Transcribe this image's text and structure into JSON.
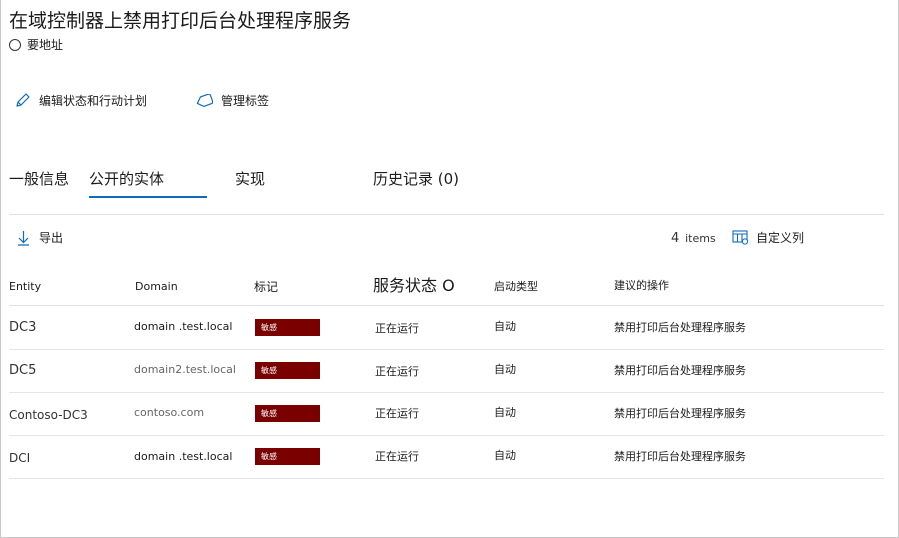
{
  "header": {
    "title": "在域控制器上禁用打印后台处理程序服务",
    "severity_label": "要地址"
  },
  "actions": {
    "edit_label": "编辑状态和行动计划",
    "tags_label": "管理标签"
  },
  "tabs": [
    {
      "label": "一般信息"
    },
    {
      "label": "公开的实体",
      "active": true
    },
    {
      "label": "实现"
    },
    {
      "label": "历史记录 (0)"
    }
  ],
  "toolbar": {
    "export_label": "导出",
    "item_count": "4",
    "items_word": "items",
    "customize_label": "自定义列"
  },
  "table": {
    "columns": [
      "Entity",
      "Domain",
      "标记",
      "服务状态 O",
      "启动类型",
      "建议的操作"
    ],
    "rows": [
      {
        "entity": "DC3",
        "domain": "domain .test.local",
        "tag": "敏感",
        "status": "正在运行",
        "startup": "自动",
        "action": "禁用打印后台处理程序服务"
      },
      {
        "entity": "DC5",
        "domain": "domain2.test.local",
        "tag": "敏感",
        "status": "正在运行",
        "startup": "自动",
        "action": "禁用打印后台处理程序服务"
      },
      {
        "entity": "Contoso-DC3",
        "domain": "contoso.com",
        "tag": "敏感",
        "status": "正在运行",
        "startup": "自动",
        "action": "禁用打印后台处理程序服务"
      },
      {
        "entity": "DCI",
        "domain": "domain .test.local",
        "tag": "敏感",
        "status": "正在运行",
        "startup": "自动",
        "action": "禁用打印后台处理程序服务"
      }
    ]
  },
  "colors": {
    "accent": "#0f6cbd",
    "tag_background": "#7a0000",
    "icon_blue": "#0f6cbd"
  },
  "icons": {
    "severity": "radio-circle-icon",
    "edit": "pencil-icon",
    "tags": "tag-icon",
    "export": "download-arrow-icon",
    "customize": "columns-icon"
  }
}
